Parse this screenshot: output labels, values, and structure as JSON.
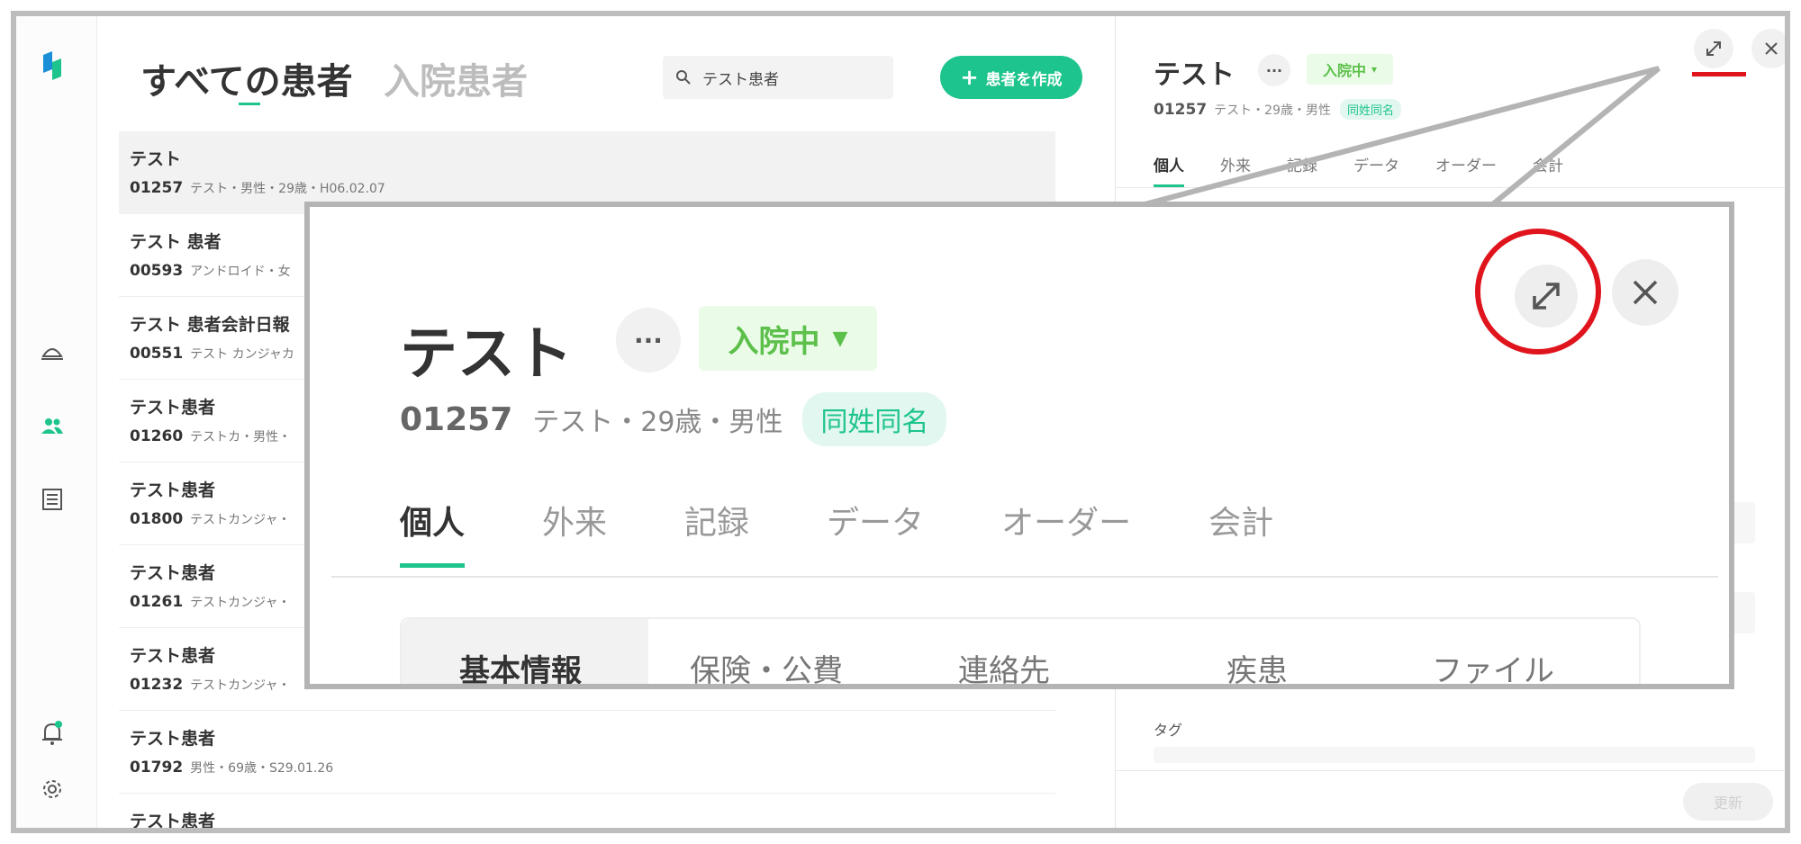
{
  "list": {
    "tabs": {
      "all": "すべての患者",
      "inpatient": "入院患者"
    },
    "search_value": "テスト患者",
    "create_button": "患者を作成",
    "items": [
      {
        "name": "テスト",
        "id": "01257",
        "meta": "テスト・男性・29歳・H06.02.07"
      },
      {
        "name": "テスト 患者",
        "id": "00593",
        "meta": "アンドロイド・女"
      },
      {
        "name": "テスト 患者会計日報",
        "id": "00551",
        "meta": "テスト カンジャカ"
      },
      {
        "name": "テスト患者",
        "id": "01260",
        "meta": "テストカ・男性・"
      },
      {
        "name": "テスト患者",
        "id": "01800",
        "meta": "テストカンジャ・"
      },
      {
        "name": "テスト患者",
        "id": "01261",
        "meta": "テストカンジャ・"
      },
      {
        "name": "テスト患者",
        "id": "01232",
        "meta": "テストカンジャ・"
      },
      {
        "name": "テスト患者",
        "id": "01792",
        "meta": "男性・69歳・S29.01.26"
      },
      {
        "name": "テスト患者",
        "id": "",
        "meta": ""
      }
    ]
  },
  "detail": {
    "name": "テスト",
    "more": "···",
    "status": "入院中",
    "status_caret": "▾",
    "id": "01257",
    "meta": "テスト・29歳・男性",
    "same_name": "同姓同名",
    "tabs": [
      "個人",
      "外来",
      "記録",
      "データ",
      "オーダー",
      "会計"
    ],
    "tag_label": "タグ",
    "update_button": "更新"
  },
  "zoom": {
    "name": "テスト",
    "more": "···",
    "status": "入院中",
    "status_caret": "▼",
    "id": "01257",
    "meta": "テスト・29歳・男性",
    "same_name": "同姓同名",
    "tabs": [
      "個人",
      "外来",
      "記録",
      "データ",
      "オーダー",
      "会計"
    ],
    "subtabs": [
      "基本情報",
      "保険・公費",
      "連絡先",
      "疾患",
      "ファイル"
    ]
  },
  "colors": {
    "accent": "#1ec48d",
    "status_green": "#5cc04a",
    "highlight_red": "#e0141c"
  }
}
